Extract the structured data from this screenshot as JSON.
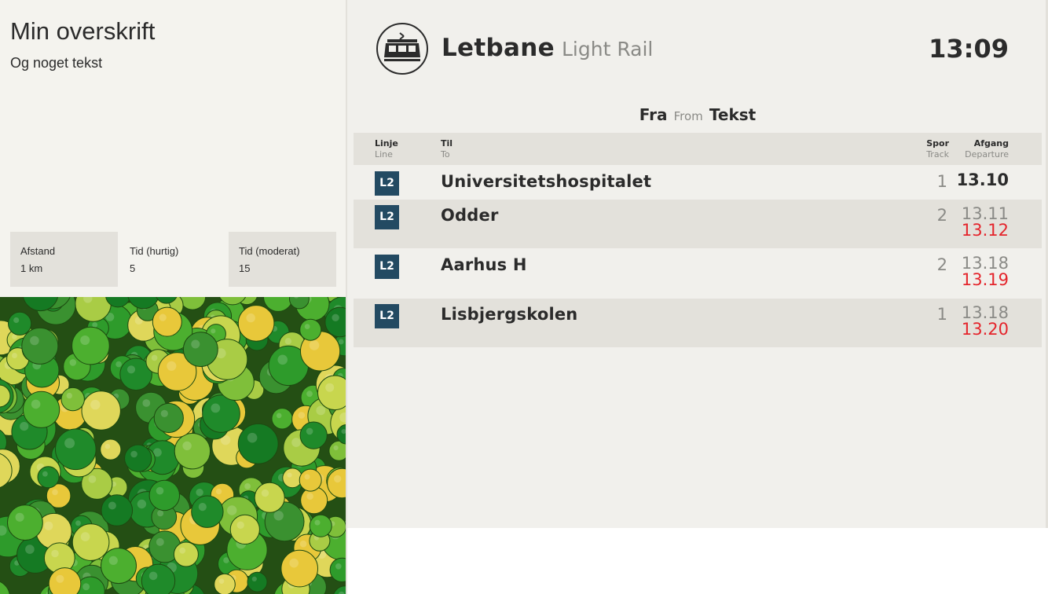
{
  "info": {
    "title": "Min overskrift",
    "text": "Og noget tekst",
    "stats": [
      {
        "label": "Afstand",
        "value": "1 km"
      },
      {
        "label": "Tid (hurtig)",
        "value": "5"
      },
      {
        "label": "Tid (moderat)",
        "value": "15"
      }
    ]
  },
  "board": {
    "brand": "Letbane",
    "brand_sub": "Light Rail",
    "time": "13:09",
    "from_label": "Fra",
    "from_sub": "From",
    "from_stop": "Tekst",
    "columns": {
      "line": "Linje",
      "line_sub": "Line",
      "to": "Til",
      "to_sub": "To",
      "track": "Spor",
      "track_sub": "Track",
      "departure": "Afgang",
      "departure_sub": "Departure"
    },
    "departures": [
      {
        "line": "L2",
        "destination": "Universitetshospitalet",
        "track": "1",
        "scheduled": "13.10",
        "expected": ""
      },
      {
        "line": "L2",
        "destination": "Odder",
        "track": "2",
        "scheduled": "13.11",
        "expected": "13.12"
      },
      {
        "line": "L2",
        "destination": "Aarhus H",
        "track": "2",
        "scheduled": "13.18",
        "expected": "13.19"
      },
      {
        "line": "L2",
        "destination": "Lisbjergskolen",
        "track": "1",
        "scheduled": "13.18",
        "expected": "13.20"
      }
    ]
  },
  "colors": {
    "line_badge": "#234a62",
    "delay": "#e4242b",
    "row_shade": "#e3e1db",
    "panel_bg": "#f1f0ec"
  },
  "icons": {
    "logo": "tram-icon"
  },
  "image": {
    "subject": "green and yellow limes"
  }
}
